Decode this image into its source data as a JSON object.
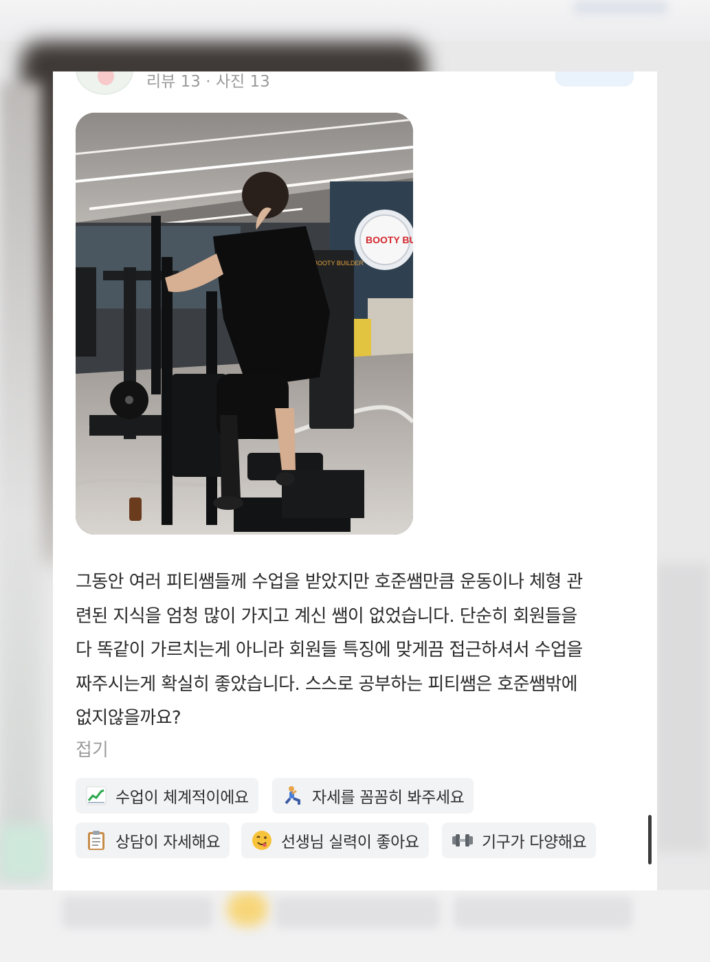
{
  "reviewer": {
    "meta": "리뷰 13 · 사진 13"
  },
  "photo": {
    "sign_text": "BOOTY BUILDER",
    "machine_text": "BOOTY BUILDER"
  },
  "review": {
    "text": "그동안 여러 피티쌤들께 수업을 받았지만 호준쌤만큼 운동이나 체형 관\n련된 지식을 엄청 많이 가지고 계신 쌤이 없었습니다. 단순히 회원들을\n다 똑같이 가르치는게 아니라 회원들 특징에 맞게끔 접근하셔서 수업을\n짜주시는게 확실히 좋았습니다. 스스로 공부하는 피티쌤은 호준쌤밖에\n없지않을까요?",
    "fold_label": "접기"
  },
  "tags": [
    {
      "icon": "chart-up-icon",
      "emoji": "📈",
      "label": "수업이 체계적이에요"
    },
    {
      "icon": "lunge-person-icon",
      "emoji": "🧎",
      "label": "자세를 꼼꼼히 봐주세요"
    },
    {
      "icon": "clipboard-icon",
      "emoji": "📋",
      "label": "상담이 자세해요"
    },
    {
      "icon": "yummy-face-icon",
      "emoji": "😋",
      "label": "선생님 실력이 좋아요"
    },
    {
      "icon": "dumbbell-icon",
      "emoji": "⚙",
      "label": "기구가 다양해요"
    }
  ]
}
